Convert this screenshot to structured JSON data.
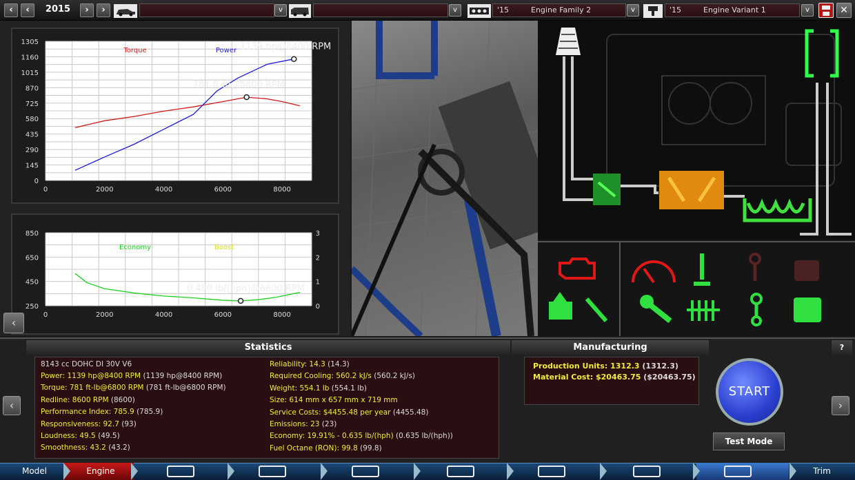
{
  "topbar": {
    "year": "2015",
    "model_select": "",
    "trim_select": "",
    "engine_family_year": "'15",
    "engine_family": "Engine Family 2",
    "engine_variant_year": "'15",
    "engine_variant": "Engine Variant 1"
  },
  "colors": {
    "torque": "#d01818",
    "power": "#1a1ad8",
    "economy": "#20d020",
    "boost": "#d8d820",
    "stat_label": "#f2ed3a"
  },
  "chart_data": [
    {
      "type": "line",
      "x_ticks": [
        "0",
        "2000",
        "4000",
        "6000",
        "8000"
      ],
      "y_ticks": [
        "1305",
        "1160",
        "1015",
        "870",
        "725",
        "580",
        "435",
        "290",
        "145",
        "0"
      ],
      "xlim": [
        0,
        9000
      ],
      "ylim": [
        0,
        1305
      ],
      "grid": true,
      "legend": [
        "Torque",
        "Power"
      ],
      "series": [
        {
          "name": "Torque",
          "x": [
            1000,
            2000,
            3000,
            4000,
            5000,
            6000,
            6800,
            7500,
            8000,
            8600
          ],
          "y": [
            495,
            560,
            600,
            650,
            690,
            740,
            781,
            765,
            740,
            700
          ]
        },
        {
          "name": "Power",
          "x": [
            1000,
            2000,
            3000,
            4000,
            5000,
            5800,
            6500,
            7500,
            8400
          ],
          "y": [
            95,
            220,
            340,
            480,
            620,
            840,
            960,
            1090,
            1139
          ]
        }
      ],
      "annotations": [
        {
          "text": "1139 hp@8400 RPM",
          "x": 8400,
          "y": 1139
        },
        {
          "text": "781 ft-lb@6800 RPM",
          "x": 6800,
          "y": 781
        }
      ]
    },
    {
      "type": "line",
      "x_ticks": [
        "0",
        "2000",
        "4000",
        "6000",
        "8000"
      ],
      "y_ticks": [
        "850",
        "650",
        "450",
        "250"
      ],
      "y2_ticks": [
        "3",
        "2",
        "1",
        "0"
      ],
      "xlim": [
        0,
        9000
      ],
      "ylim": [
        250,
        850
      ],
      "grid": true,
      "legend": [
        "Economy",
        "Boost"
      ],
      "series": [
        {
          "name": "Economy",
          "x": [
            1000,
            1400,
            2000,
            3000,
            4000,
            5000,
            6000,
            6600,
            7200,
            7800,
            8600
          ],
          "y": [
            515,
            440,
            390,
            355,
            330,
            315,
            295,
            290,
            300,
            320,
            360
          ]
        }
      ],
      "annotations": [
        {
          "text": "0.489 lb/(hph)@6600 RPM",
          "x": 6600,
          "y": 290
        }
      ]
    }
  ],
  "statistics": {
    "title": "Statistics",
    "engine_name": "8143 cc DOHC DI 30V V6",
    "left": [
      {
        "label": "Power:",
        "value": "1139 hp@8400 RPM",
        "paren": "(1139 hp@8400 RPM)"
      },
      {
        "label": "Torque:",
        "value": "781 ft-lb@6800 RPM",
        "paren": "(781 ft-lb@6800 RPM)"
      },
      {
        "label": "Redline:",
        "value": "8600 RPM",
        "paren": "(8600)"
      },
      {
        "label": "Performance Index:",
        "value": "785.9",
        "paren": "(785.9)"
      },
      {
        "label": "Responsiveness:",
        "value": "92.7",
        "paren": "(93)"
      },
      {
        "label": "Loudness:",
        "value": "49.5",
        "paren": "(49.5)"
      },
      {
        "label": "Smoothness:",
        "value": "43.2",
        "paren": "(43.2)"
      }
    ],
    "right": [
      {
        "label": "Reliability:",
        "value": "14.3",
        "paren": "(14.3)"
      },
      {
        "label": "Required Cooling:",
        "value": "560.2 kJ/s",
        "paren": "(560.2 kJ/s)"
      },
      {
        "label": "Weight:",
        "value": "554.1 lb",
        "paren": "(554.1 lb)"
      },
      {
        "label": "Size:",
        "value": "614 mm x 657 mm x 719 mm",
        "paren": ""
      },
      {
        "label": "Service Costs:",
        "value": "$4455.48 per year",
        "paren": "(4455.48)"
      },
      {
        "label": "Emissions:",
        "value": "23",
        "paren": "(23)"
      },
      {
        "label": "Economy:",
        "value": "19.91% - 0.635 lb/(hph)",
        "paren": "(0.635 lb/(hph))"
      },
      {
        "label": "Fuel Octane (RON):",
        "value": "99.8",
        "paren": "(99.8)"
      }
    ]
  },
  "manufacturing": {
    "title": "Manufacturing",
    "production_label": "Production Units:",
    "production_value": "1312.3",
    "production_paren": "(1312.3)",
    "material_label": "Material Cost:",
    "material_value": "$20463.75",
    "material_paren": "($20463.75)"
  },
  "controls": {
    "start": "START",
    "test_mode": "Test Mode",
    "help": "?"
  },
  "nav": {
    "model": "Model",
    "engine": "Engine",
    "trim": "Trim"
  }
}
